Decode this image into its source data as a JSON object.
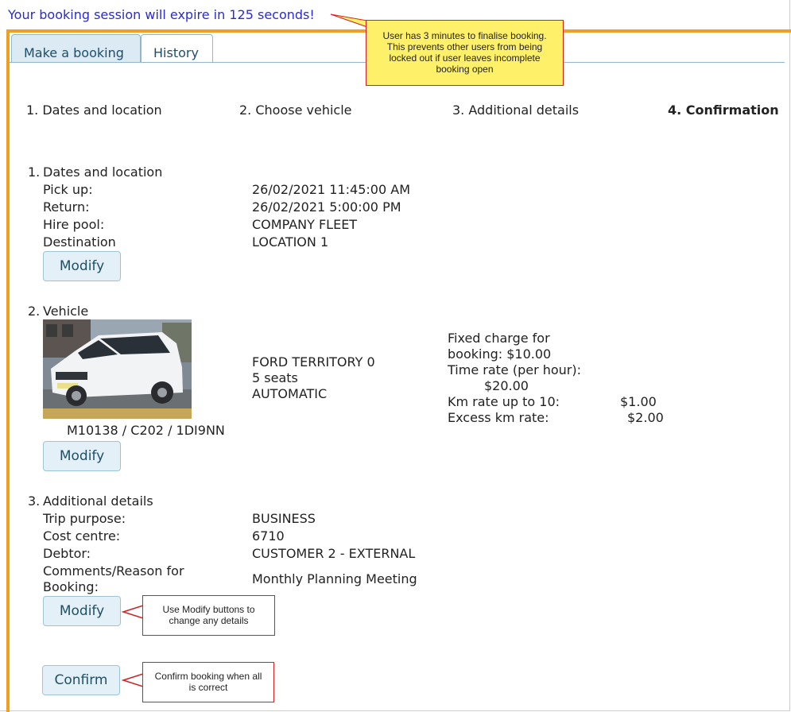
{
  "session": {
    "expire_text": "Your booking session will expire in 125 seconds!"
  },
  "tabs": [
    {
      "label": "Make a booking"
    },
    {
      "label": "History"
    }
  ],
  "steps": [
    {
      "label": "1. Dates and location"
    },
    {
      "label": "2. Choose vehicle"
    },
    {
      "label": "3. Additional details"
    },
    {
      "label": "4. Confirmation"
    }
  ],
  "section1": {
    "num": "1.",
    "heading": "Dates and location",
    "rows": [
      {
        "label": "Pick up:",
        "value": "26/02/2021 11:45:00 AM"
      },
      {
        "label": "Return:",
        "value": "26/02/2021 5:00:00 PM"
      },
      {
        "label": "Hire pool:",
        "value": "COMPANY FLEET"
      },
      {
        "label": "Destination",
        "value": "LOCATION 1"
      }
    ],
    "modify_label": "Modify"
  },
  "section2": {
    "num": "2.",
    "heading": "Vehicle",
    "vehicle": {
      "make_model": "FORD   TERRITORY  0",
      "seats": "5 seats",
      "transmission": "AUTOMATIC",
      "plate_line": "M10138 / C202 / 1DI9NN"
    },
    "rates": {
      "fixed_line1": "Fixed charge for",
      "fixed_line2": "booking:  $10.00",
      "time_line1": "Time rate (per hour):",
      "time_line2": "$20.00",
      "km_label": "Km rate up to 10:",
      "km_value": "$1.00",
      "excess_label": "Excess km rate:",
      "excess_value": "$2.00"
    },
    "modify_label": "Modify"
  },
  "section3": {
    "num": "3.",
    "heading": "Additional details",
    "rows": [
      {
        "label": "Trip purpose:",
        "value": "BUSINESS"
      },
      {
        "label": "Cost centre:",
        "value": "6710"
      },
      {
        "label": "Debtor:",
        "value": "CUSTOMER 2 - EXTERNAL"
      }
    ],
    "comments_label_line1": "Comments/Reason for",
    "comments_label_line2": "Booking:",
    "comments_value": "Monthly Planning Meeting",
    "modify_label": "Modify"
  },
  "confirm_label": "Confirm",
  "callouts": {
    "timer_note": "User has 3 minutes to finalise booking. This prevents other users from being locked out if user leaves incomplete booking open",
    "modify_note": "Use Modify buttons to change any details",
    "confirm_note": "Confirm booking when all is correct"
  },
  "colors": {
    "accent_border": "#f0a020",
    "callout_red": "#d42020",
    "callout_yellow": "#fff06a",
    "link_blue": "#2a2ad6"
  }
}
